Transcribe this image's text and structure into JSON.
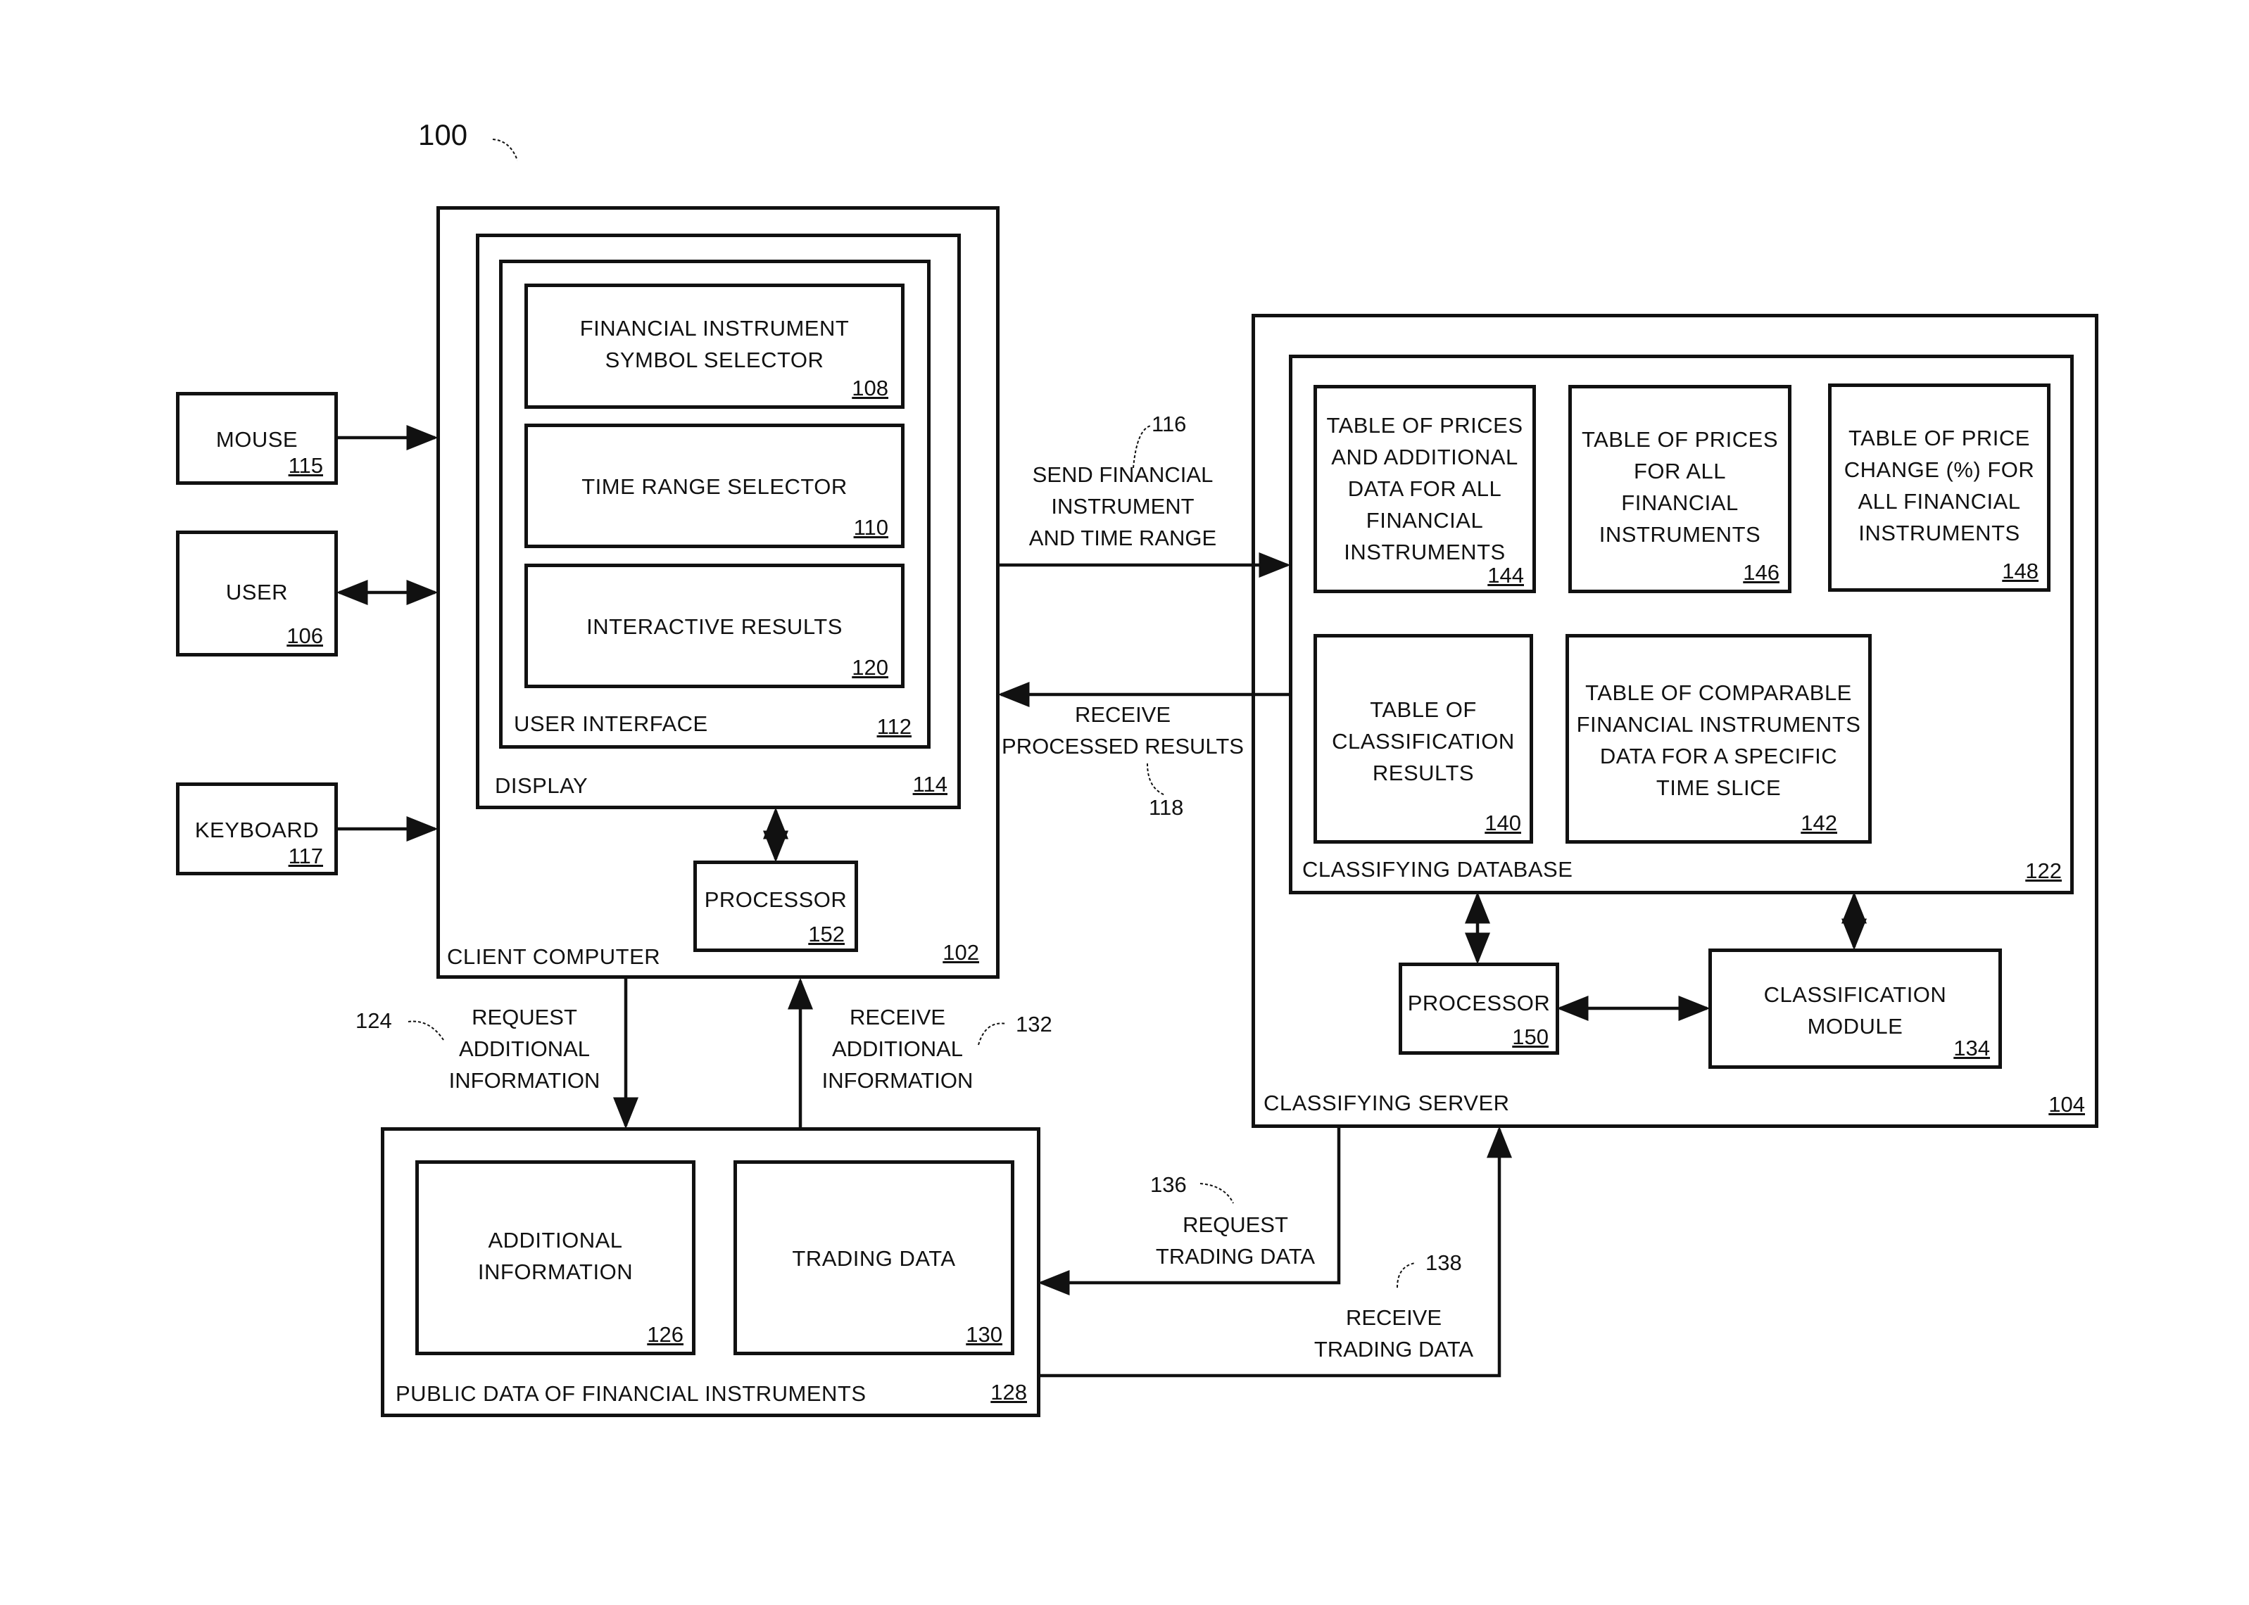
{
  "figure": {
    "number": "100",
    "client_computer": {
      "label": "CLIENT COMPUTER",
      "ref": "102"
    },
    "display": {
      "label": "DISPLAY",
      "ref": "114"
    },
    "user_interface": {
      "label": "USER INTERFACE",
      "ref": "112"
    },
    "symbol_selector": {
      "label": "FINANCIAL INSTRUMENT\nSYMBOL SELECTOR",
      "ref": "108"
    },
    "time_range_selector": {
      "label": "TIME RANGE SELECTOR",
      "ref": "110"
    },
    "interactive_results": {
      "label": "INTERACTIVE RESULTS",
      "ref": "120"
    },
    "client_processor": {
      "label": "PROCESSOR",
      "ref": "152"
    },
    "mouse": {
      "label": "MOUSE",
      "ref": "115"
    },
    "user": {
      "label": "USER",
      "ref": "106"
    },
    "keyboard": {
      "label": "KEYBOARD",
      "ref": "117"
    },
    "classifying_server": {
      "label": "CLASSIFYING SERVER",
      "ref": "104"
    },
    "classifying_database": {
      "label": "CLASSIFYING DATABASE",
      "ref": "122"
    },
    "table_prices_additional": {
      "label": "TABLE OF PRICES\nAND ADDITIONAL\nDATA FOR ALL\nFINANCIAL\nINSTRUMENTS",
      "ref": "144"
    },
    "table_prices": {
      "label": "TABLE OF PRICES\nFOR ALL\nFINANCIAL\nINSTRUMENTS",
      "ref": "146"
    },
    "table_price_change": {
      "label": "TABLE OF PRICE\nCHANGE (%) FOR\nALL FINANCIAL\nINSTRUMENTS",
      "ref": "148"
    },
    "table_classification": {
      "label": "TABLE OF\nCLASSIFICATION\nRESULTS",
      "ref": "140"
    },
    "table_comparable": {
      "label": "TABLE OF COMPARABLE\nFINANCIAL INSTRUMENTS\nDATA FOR A SPECIFIC\nTIME SLICE",
      "ref": "142"
    },
    "server_processor": {
      "label": "PROCESSOR",
      "ref": "150"
    },
    "classification_module": {
      "label": "CLASSIFICATION\nMODULE",
      "ref": "134"
    },
    "public_data": {
      "label": "PUBLIC DATA OF FINANCIAL INSTRUMENTS",
      "ref": "128"
    },
    "additional_information": {
      "label": "ADDITIONAL\nINFORMATION",
      "ref": "126"
    },
    "trading_data": {
      "label": "TRADING DATA",
      "ref": "130"
    }
  },
  "flows": {
    "send": {
      "label": "SEND FINANCIAL\nINSTRUMENT\nAND TIME RANGE",
      "ref": "116"
    },
    "receive_results": {
      "label": "RECEIVE\nPROCESSED RESULTS",
      "ref": "118"
    },
    "request_additional": {
      "label": "REQUEST\nADDITIONAL\nINFORMATION",
      "ref": "124"
    },
    "receive_additional": {
      "label": "RECEIVE\nADDITIONAL\nINFORMATION",
      "ref": "132"
    },
    "request_trading": {
      "label": "REQUEST\nTRADING DATA",
      "ref": "136"
    },
    "receive_trading": {
      "label": "RECEIVE\nTRADING DATA",
      "ref": "138"
    }
  }
}
